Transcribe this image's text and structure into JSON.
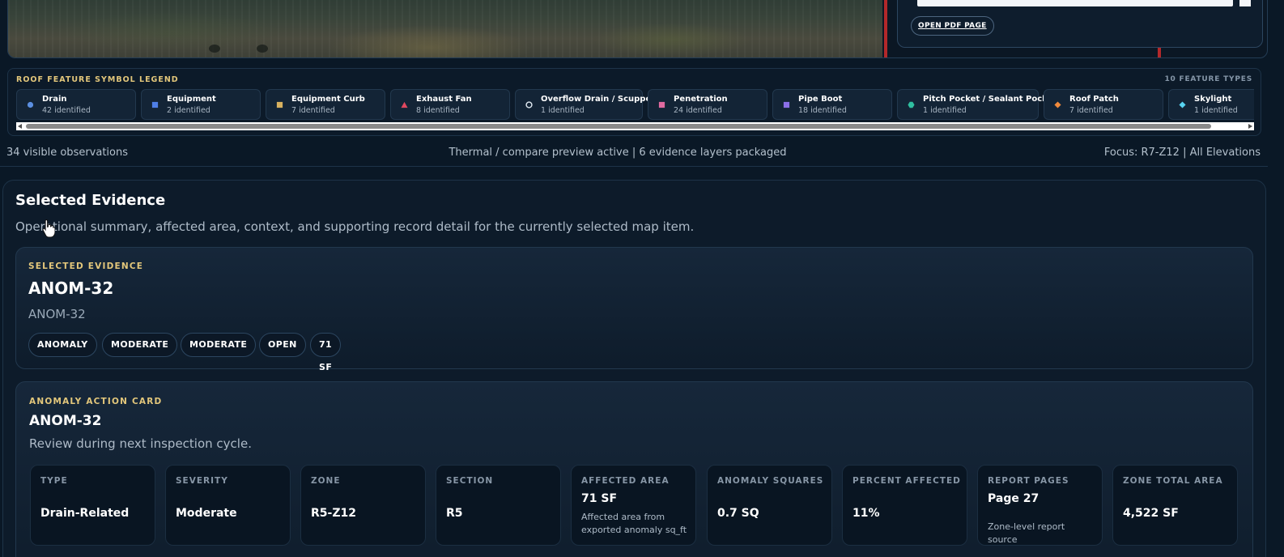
{
  "side_panel": {
    "open_pdf_label": "OPEN PDF PAGE"
  },
  "legend": {
    "title": "ROOF FEATURE SYMBOL LEGEND",
    "count": "10 FEATURE TYPES",
    "items": [
      {
        "name": "Drain",
        "count": "42 identified",
        "color": "#5b8fe0",
        "shape": "circle"
      },
      {
        "name": "Equipment",
        "count": "2 identified",
        "color": "#4f7fe6",
        "shape": "square"
      },
      {
        "name": "Equipment Curb",
        "count": "7 identified",
        "color": "#d7b15f",
        "shape": "square"
      },
      {
        "name": "Exhaust Fan",
        "count": "8 identified",
        "color": "#e0485f",
        "shape": "triangle"
      },
      {
        "name": "Overflow Drain / Scupper",
        "count": "1 identified",
        "color": "#dfe8f0",
        "shape": "ring"
      },
      {
        "name": "Penetration",
        "count": "24 identified",
        "color": "#e06aa0",
        "shape": "square"
      },
      {
        "name": "Pipe Boot",
        "count": "18 identified",
        "color": "#8b6fe8",
        "shape": "square"
      },
      {
        "name": "Pitch Pocket / Sealant Pocket",
        "count": "1 identified",
        "color": "#2fbfa0",
        "shape": "hexagon"
      },
      {
        "name": "Roof Patch",
        "count": "7 identified",
        "color": "#f08a3c",
        "shape": "diamond"
      },
      {
        "name": "Skylight",
        "count": "1 identified",
        "color": "#57d3f0",
        "shape": "diamond"
      }
    ]
  },
  "status": {
    "left": "34 visible observations",
    "center": "Thermal / compare preview active | 6 evidence layers packaged",
    "right": "Focus: R7-Z12 | All Elevations"
  },
  "selected_evidence": {
    "title": "Selected Evidence",
    "subtitle": "Operational summary, affected area, context, and supporting record detail for the currently selected map item.",
    "card": {
      "kicker": "SELECTED EVIDENCE",
      "title": "ANOM-32",
      "subtitle": "ANOM-32",
      "chips": [
        "ANOMALY",
        "MODERATE",
        "MODERATE",
        "OPEN",
        "71 SF"
      ]
    }
  },
  "action_card": {
    "kicker": "ANOMALY ACTION CARD",
    "title": "ANOM-32",
    "subtitle": "Review during next inspection cycle.",
    "metrics": [
      {
        "label": "TYPE",
        "value": "Drain-Related"
      },
      {
        "label": "SEVERITY",
        "value": "Moderate"
      },
      {
        "label": "ZONE",
        "value": "R5-Z12"
      },
      {
        "label": "SECTION",
        "value": "R5"
      },
      {
        "label": "AFFECTED AREA",
        "value": "71 SF",
        "note": "Affected area from exported anomaly sq_ft"
      },
      {
        "label": "ANOMALY SQUARES",
        "value": "0.7 SQ"
      },
      {
        "label": "PERCENT AFFECTED",
        "value": "11%"
      },
      {
        "label": "REPORT PAGES",
        "value": "Page 27",
        "note": "Zone-level report source"
      },
      {
        "label": "ZONE TOTAL AREA",
        "value": "4,522 SF"
      }
    ]
  }
}
